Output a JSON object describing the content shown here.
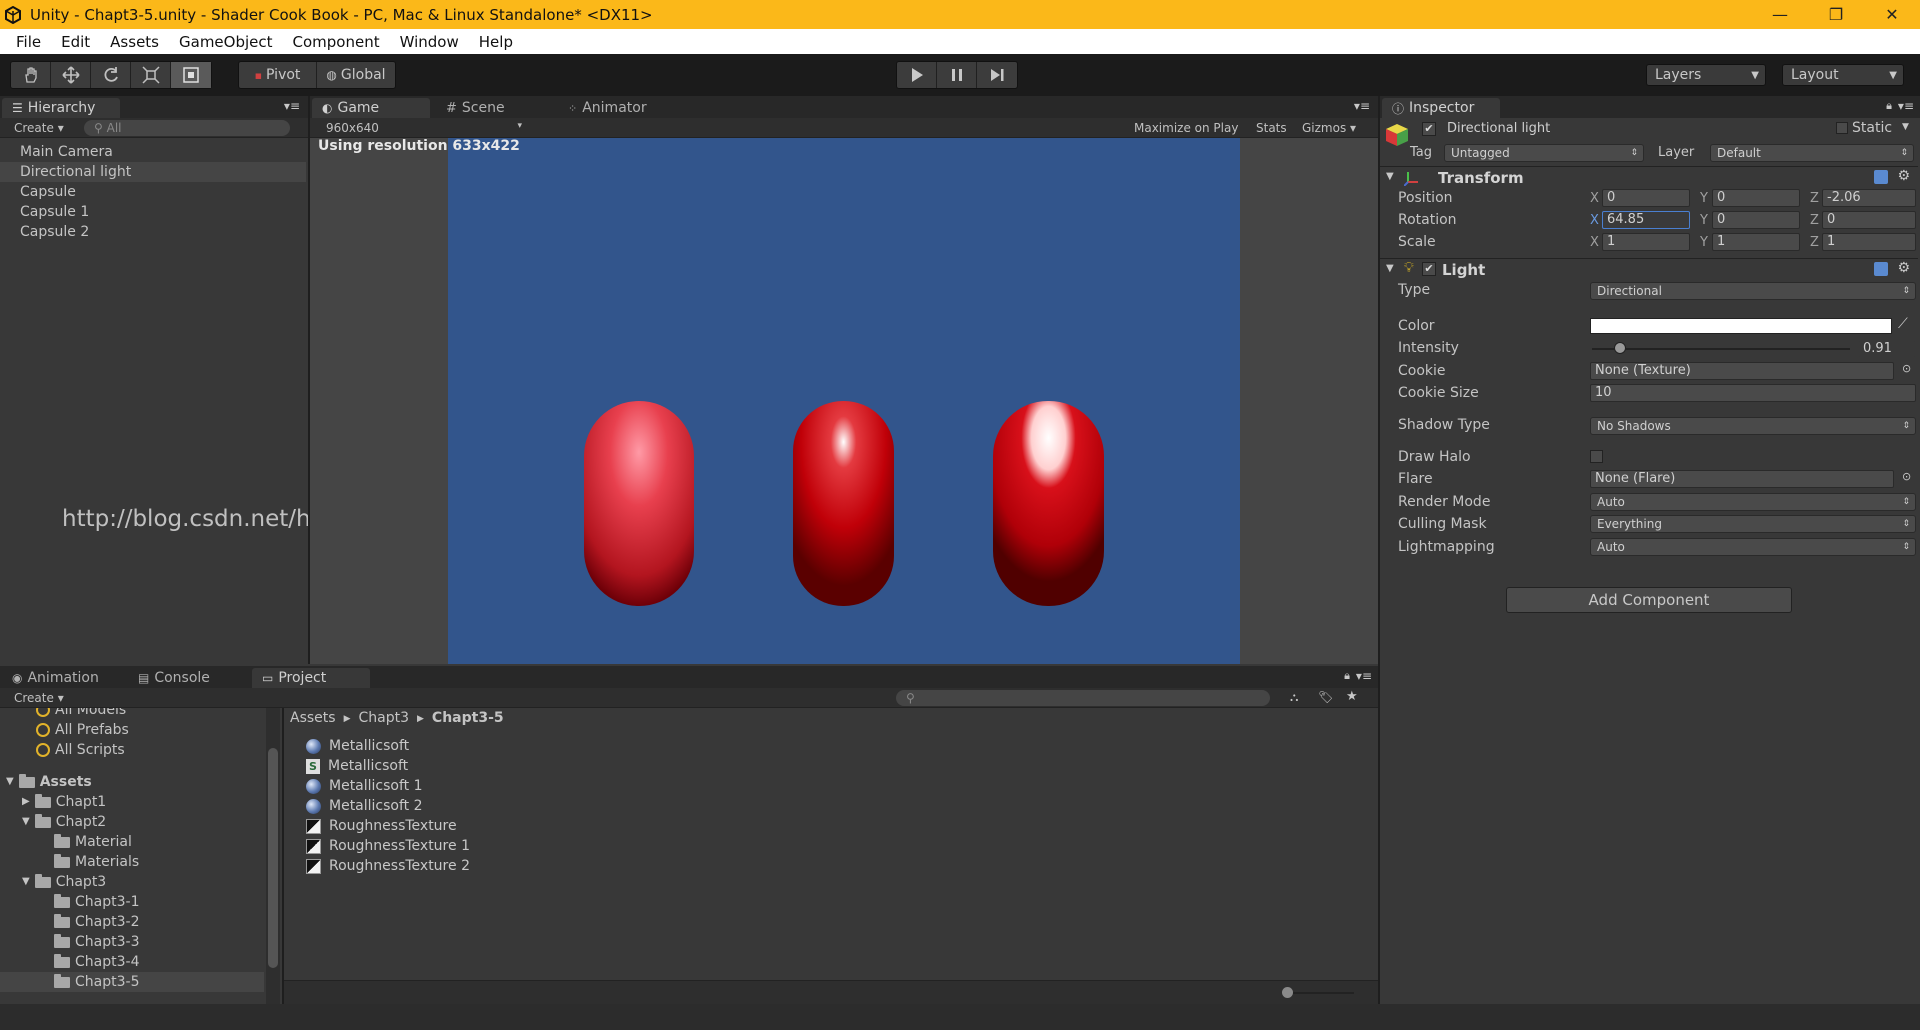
{
  "window": {
    "title": "Unity - Chapt3-5.unity - Shader Cook Book - PC, Mac & Linux Standalone* <DX11>",
    "buttons": [
      "—",
      "❐",
      "✕"
    ]
  },
  "menu": [
    "File",
    "Edit",
    "Assets",
    "GameObject",
    "Component",
    "Window",
    "Help"
  ],
  "toolbar": {
    "pivot_label": "Pivot",
    "global_label": "Global",
    "layers_label": "Layers",
    "layout_label": "Layout"
  },
  "hierarchy": {
    "tab": "Hierarchy",
    "create": "Create",
    "search_placeholder": "All",
    "items": [
      "Main Camera",
      "Directional light",
      "Capsule",
      "Capsule 1",
      "Capsule 2"
    ],
    "selected_index": 1
  },
  "game": {
    "tabs": [
      "Game",
      "Scene",
      "Animator"
    ],
    "resolution_dropdown": "960x640",
    "maximize_on_play": "Maximize on Play",
    "stats": "Stats",
    "gizmos": "Gizmos",
    "resolution_text": "Using resolution 633x422",
    "capsule_color": "#c00000",
    "background_color": "#32558c"
  },
  "watermark": "http://blog.csdn.net/huutu",
  "inspector": {
    "tab": "Inspector",
    "object_name": "Directional light",
    "static_label": "Static",
    "tag_label": "Tag",
    "tag_value": "Untagged",
    "layer_label": "Layer",
    "layer_value": "Default",
    "transform": {
      "title": "Transform",
      "position_label": "Position",
      "rotation_label": "Rotation",
      "scale_label": "Scale",
      "position": {
        "x": "0",
        "y": "0",
        "z": "-2.06"
      },
      "rotation": {
        "x": "64.85",
        "y": "0",
        "z": "0"
      },
      "scale": {
        "x": "1",
        "y": "1",
        "z": "1"
      }
    },
    "light": {
      "title": "Light",
      "type_label": "Type",
      "type_value": "Directional",
      "color_label": "Color",
      "color_value": "#ffffff",
      "intensity_label": "Intensity",
      "intensity_value": "0.91",
      "intensity_fraction": 0.11,
      "cookie_label": "Cookie",
      "cookie_value": "None (Texture)",
      "cookie_size_label": "Cookie Size",
      "cookie_size_value": "10",
      "shadow_type_label": "Shadow Type",
      "shadow_type_value": "No Shadows",
      "draw_halo_label": "Draw Halo",
      "flare_label": "Flare",
      "flare_value": "None (Flare)",
      "render_mode_label": "Render Mode",
      "render_mode_value": "Auto",
      "culling_mask_label": "Culling Mask",
      "culling_mask_value": "Everything",
      "lightmapping_label": "Lightmapping",
      "lightmapping_value": "Auto"
    },
    "add_component": "Add Component"
  },
  "bottom": {
    "tabs": [
      "Animation",
      "Console",
      "Project"
    ],
    "create": "Create",
    "favorites": [
      "All Models",
      "All Prefabs",
      "All Scripts"
    ],
    "tree": {
      "assets": "Assets",
      "chapt1": "Chapt1",
      "chapt2": "Chapt2",
      "material": "Material",
      "materials": "Materials",
      "chapt3": "Chapt3",
      "chapt3_children": [
        "Chapt3-1",
        "Chapt3-2",
        "Chapt3-3",
        "Chapt3-4",
        "Chapt3-5"
      ]
    },
    "breadcrumb": [
      "Assets",
      "Chapt3",
      "Chapt3-5"
    ],
    "files": [
      {
        "name": "Metallicsoft",
        "icon": "material-sphere-icon"
      },
      {
        "name": "Metallicsoft",
        "icon": "shader-script-icon"
      },
      {
        "name": "Metallicsoft 1",
        "icon": "material-sphere-icon"
      },
      {
        "name": "Metallicsoft 2",
        "icon": "material-sphere-icon"
      },
      {
        "name": "RoughnessTexture",
        "icon": "texture-icon"
      },
      {
        "name": "RoughnessTexture 1",
        "icon": "texture-icon"
      },
      {
        "name": "RoughnessTexture 2",
        "icon": "texture-icon"
      }
    ]
  }
}
